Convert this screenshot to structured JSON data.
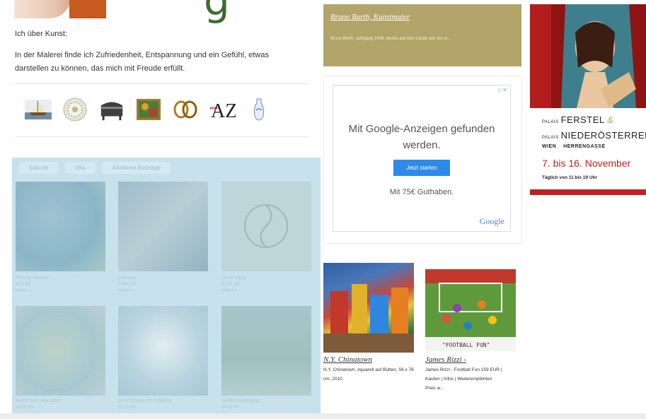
{
  "header": {
    "cut_heading": "g"
  },
  "about": {
    "label": "Ich über Kunst:",
    "text": "In der Malerei finde ich Zufriedenheit, Entspannung und ein Gefühl, etwas darstellen zu können, das mich mit Freude erfüllt."
  },
  "icon_strip": {
    "items": [
      "ship-painting-icon",
      "porcelain-plate-icon",
      "antique-chest-icon",
      "painting-icon",
      "brooch-icon",
      "a-z-icon",
      "vase-icon"
    ],
    "az_label": "AZ"
  },
  "gallery": {
    "tabs": [
      "Galerie",
      "Vita",
      "Ähnliche Beiträge"
    ],
    "tiles": [
      {
        "caption": "Blaues Wasser\n€10.00\nteilen »"
      },
      {
        "caption": "Interieur\n€450.00\nteilen »"
      },
      {
        "caption": "Yin & Yang\n€120.00\nteilen »"
      },
      {
        "caption": "Buddha im Abendrot\n€415.00"
      },
      {
        "caption": "Kirschblüten im Frühling\n€215.00"
      },
      {
        "caption": "Waldspaziergang\n€415.00"
      }
    ]
  },
  "artist_box": {
    "title": "Bruno Barth, Kunstmaler",
    "subtitle": "Bruno Barth, Jahrgang 1949, wuchs auf dem Lande auf, wo er..."
  },
  "ad": {
    "close_label": "▷✕",
    "headline": "Mit Google-Anzeigen gefunden werden.",
    "button_label": "Jetzt starten",
    "subline": "Mit 75€ Guthaben.",
    "brand": "Google"
  },
  "products": [
    {
      "title": "N.Y. Chinatown",
      "description": "N.Y. Chinatown, Aquarell auf Bütten, 56 x 76 cm, 2010"
    },
    {
      "title": "James Rizzi -",
      "description": "James Rizzi - Football Fun 159 EUR | Kaufen | Infos | Weiterempfehlen\nPreis w...",
      "image_text": "\"FOOTBALL FUN\""
    }
  ],
  "banner": {
    "palais_label": "PALAIS",
    "venue1": "FERSTEL",
    "ampersand": "&",
    "venue2": "NIEDERÖSTERREICH",
    "city": "WIEN",
    "street": "HERRENGASSE",
    "dates": "7. bis 16. November",
    "hours": "Täglich von 11 bis 19 Uhr"
  },
  "colors": {
    "gold": "#b3a56a",
    "overlay": "#c7e2ec",
    "ad_button": "#2d8ae8",
    "banner_red": "#c41e1e"
  }
}
